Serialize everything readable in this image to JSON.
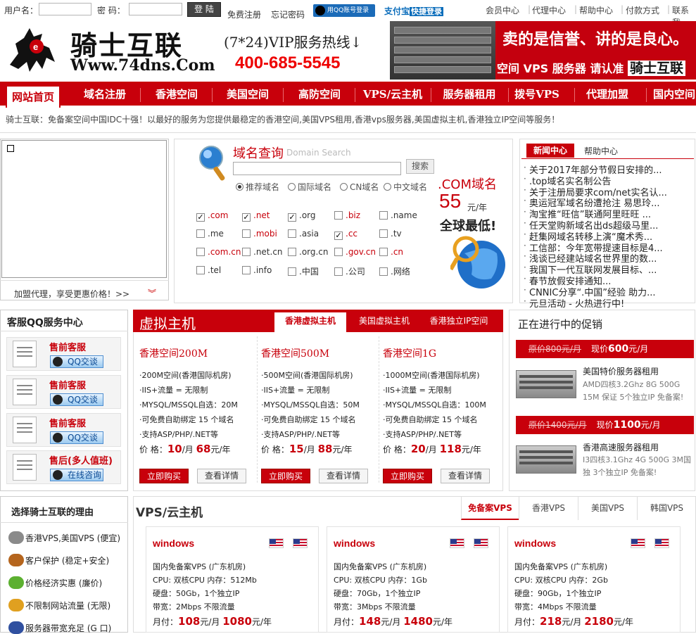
{
  "topbar": {
    "username_label": "用户名：",
    "password_label": "密  码：",
    "login_button": "登 陆",
    "register": "免费注册",
    "forgot": "忘记密码",
    "qq_login": "用QQ账号登录",
    "alipay_brand": "支付宝",
    "alipay_quick": "快捷登录",
    "right_links": [
      "会员中心",
      "代理中心",
      "帮助中心",
      "付款方式",
      "联系我"
    ]
  },
  "header": {
    "logo_name": "骑士互联",
    "logo_url": "Www.74dns.Com",
    "hotline_label": "(7*24)VIP服务热线↓",
    "hotline_number": "400-685-5545",
    "banner_slogan": "卖的是信誉、讲的是良心。",
    "banner_sub": "空间 VPS 服务器 请认准",
    "banner_brand": "骑士互联"
  },
  "nav": [
    "网站首页",
    "域名注册",
    "香港空间",
    "美国空间",
    "高防空间",
    "VPS/云主机",
    "服务器租用",
    "拨号VPS",
    "代理加盟",
    "国内空间"
  ],
  "tagline": "骑士互联：免备案空间中国IDC十强！以最好的服务为您提供最稳定的香港空间,美国VPS租用,香港vps服务器,美国虚拟主机,香港独立IP空间等服务！",
  "agent_tip": "加盟代理，享受更惠价格！>>",
  "domain_search": {
    "title": "域名查询",
    "subtitle": "Domain Search",
    "search_button": "搜索",
    "input_value": "",
    "radios": [
      {
        "label": "推荐域名",
        "selected": true
      },
      {
        "label": "国际域名",
        "selected": false
      },
      {
        "label": "CN域名",
        "selected": false
      },
      {
        "label": "中文域名",
        "selected": false
      }
    ],
    "tlds": [
      {
        "label": ".com",
        "checked": true,
        "red": true
      },
      {
        "label": ".net",
        "checked": true,
        "red": true
      },
      {
        "label": ".org",
        "checked": true,
        "red": false
      },
      {
        "label": ".biz",
        "checked": false,
        "red": true
      },
      {
        "label": ".name",
        "checked": false,
        "red": false
      },
      {
        "label": ".me",
        "checked": false,
        "red": false
      },
      {
        "label": ".mobi",
        "checked": false,
        "red": true
      },
      {
        "label": ".asia",
        "checked": false,
        "red": false
      },
      {
        "label": ".cc",
        "checked": true,
        "red": true
      },
      {
        "label": ".tv",
        "checked": false,
        "red": false
      },
      {
        "label": ".com.cn",
        "checked": false,
        "red": true
      },
      {
        "label": ".net.cn",
        "checked": false,
        "red": false
      },
      {
        "label": ".org.cn",
        "checked": false,
        "red": false
      },
      {
        "label": ".gov.cn",
        "checked": false,
        "red": true
      },
      {
        "label": ".cn",
        "checked": false,
        "red": true
      },
      {
        "label": ".tel",
        "checked": false,
        "red": false
      },
      {
        "label": ".info",
        "checked": false,
        "red": false
      },
      {
        "label": ".中国",
        "checked": false,
        "red": false
      },
      {
        "label": ".公司",
        "checked": false,
        "red": false
      },
      {
        "label": ".网络",
        "checked": false,
        "red": false
      }
    ],
    "promo_domain": ".COM域名",
    "promo_price": "55",
    "promo_unit": "元/年",
    "promo_text": "全球最低!"
  },
  "news": {
    "tab_news": "新闻中心",
    "tab_help": "帮助中心",
    "items": [
      "关于2017年部分节假日安排的...",
      ".top域名实名制公告",
      "关于注册局要求com/net实名认...",
      "奥运冠军域名纷遭抢注 易思玲...",
      "淘宝推“旺信”联通阿里旺旺 ...",
      "任天堂购新域名出ds超级马里...",
      "赶集网域名转移上演“魔术秀...",
      "工信部：今年宽带提速目标是4...",
      "浅谈已经建站域名世界里的数...",
      "我国下一代互联网发展目标、...",
      "春节放假安排通知...",
      "CNNIC分享“.中国”经验 助力...",
      "元旦活动 - 火热进行中!"
    ]
  },
  "qq_service": {
    "title": "客服QQ服务中心",
    "cards": [
      {
        "label": "售前客服",
        "button": "QQ交谈"
      },
      {
        "label": "售前客服",
        "button": "QQ交谈"
      },
      {
        "label": "售前客服",
        "button": "QQ交谈"
      },
      {
        "label": "售后(多人值班)",
        "button": "在线咨询"
      }
    ]
  },
  "virtual_host": {
    "title": "虚拟主机",
    "tabs": [
      "香港虚拟主机",
      "美国虚拟主机",
      "香港独立IP空间"
    ],
    "plans": [
      {
        "name": "香港空间200M",
        "lines": [
          "·200M空间(香港国际机房)",
          "·IIS+流量 = 无限制",
          "·MYSQL/MSSQL自选：20M",
          "·可免费自助绑定 15 个域名",
          "·支持ASP/PHP/.NET等"
        ],
        "price_label": "价  格：",
        "monthly": "10",
        "per_month": "/月",
        "yearly": "68",
        "per_year": "元/年",
        "buy": "立即购买",
        "detail": "查看详情"
      },
      {
        "name": "香港空间500M",
        "lines": [
          "·500M空间(香港国际机房)",
          "·IIS+流量 = 无限制",
          "·MYSQL/MSSQL自选：50M",
          "·可免费自助绑定 15 个域名",
          "·支持ASP/PHP/.NET等"
        ],
        "price_label": "价  格：",
        "monthly": "15",
        "per_month": "/月",
        "yearly": "88",
        "per_year": "元/年",
        "buy": "立即购买",
        "detail": "查看详情"
      },
      {
        "name": "香港空间1G",
        "lines": [
          "·1000M空间(香港国际机房)",
          "·IIS+流量 = 无限制",
          "·MYSQL/MSSQL自选：100M",
          "·可免费自助绑定 15 个域名",
          "·支持ASP/PHP/.NET等"
        ],
        "price_label": "价  格：",
        "monthly": "20",
        "per_month": "/月",
        "yearly": "118",
        "per_year": "元/年",
        "buy": "立即购买",
        "detail": "查看详情"
      }
    ]
  },
  "promotions": {
    "title": "正在进行中的促销",
    "items": [
      {
        "old": "原价800元/月",
        "now_label": "现价",
        "now": "600",
        "unit": "元/月",
        "name": "美国特价服务器租用",
        "desc": "AMD四核3.2Ghz 8G 500G 15M 保证 5个独立IP 免备案!"
      },
      {
        "old": "原价1400元/月",
        "now_label": "现价",
        "now": "1100",
        "unit": "元/月",
        "name": "香港高速服务器租用",
        "desc": "I3四核3.1Ghz 4G 500G 3M国 独 3个独立IP 免备案!"
      }
    ]
  },
  "reasons": {
    "title": "选择骑士互联的理由",
    "items": [
      {
        "text": "香港VPS,美国VPS (便宜)",
        "icon": "anchor-icon",
        "color": "#8a8a8a"
      },
      {
        "text": "客户保护 (稳定+安全)",
        "icon": "briefcase-icon",
        "color": "#b5651d"
      },
      {
        "text": "价格经济实惠 (廉价)",
        "icon": "apple-icon",
        "color": "#5cb030"
      },
      {
        "text": "不限制网站流量 (无限)",
        "icon": "bell-icon",
        "color": "#e0a020"
      },
      {
        "text": "服务器带宽充足 (G 口)",
        "icon": "flag-icon",
        "color": "#3050a0"
      }
    ]
  },
  "vps": {
    "title": "VPS/云主机",
    "tabs": [
      "免备案VPS",
      "香港VPS",
      "美国VPS",
      "韩国VPS"
    ],
    "cards": [
      {
        "os": "windows",
        "lines": [
          "国内免备案VPS (广东机房)",
          "CPU: 双核CPU 内存：512Mb",
          "硬盘：50Gb，1个独立IP",
          "带宽：2Mbps 不限流量"
        ],
        "price_label": "月付：",
        "monthly": "108",
        "per_month": "元/月",
        "yearly": "1080",
        "per_year": "元/年"
      },
      {
        "os": "windows",
        "lines": [
          "国内免备案VPS (广东机房)",
          "CPU: 双核CPU 内存：1Gb",
          "硬盘：70Gb，1个独立IP",
          "带宽：3Mbps 不限流量"
        ],
        "price_label": "月付：",
        "monthly": "148",
        "per_month": "元/月",
        "yearly": "1480",
        "per_year": "元/年"
      },
      {
        "os": "windows",
        "lines": [
          "国内免备案VPS (广东机房)",
          "CPU: 双核CPU 内存：2Gb",
          "硬盘：90Gb，1个独立IP",
          "带宽：4Mbps 不限流量"
        ],
        "price_label": "月付：",
        "monthly": "218",
        "per_month": "元/月",
        "yearly": "2180",
        "per_year": "元/年"
      }
    ]
  },
  "colors": {
    "brand_red": "#c8000b",
    "accent_blue": "#1b6bb8"
  }
}
